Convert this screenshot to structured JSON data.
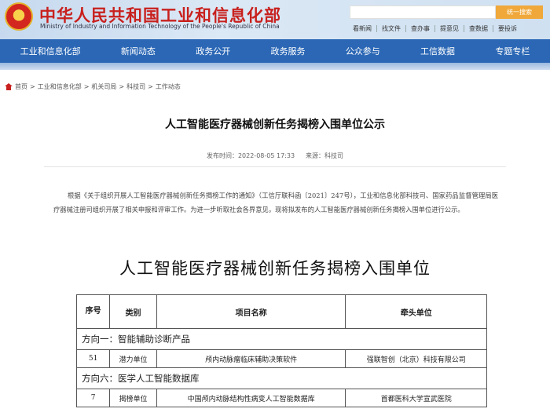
{
  "header": {
    "site_title": "中华人民共和国工业和信息化部",
    "site_subtitle": "Ministry of Industry and Information Technology of the People's Republic of China",
    "search_button": "统一搜索",
    "quick_links": [
      "看新闻",
      "找文件",
      "查办事",
      "提意见",
      "查数据",
      "要投诉"
    ]
  },
  "nav": {
    "items": [
      "工业和信息化部",
      "新闻动态",
      "政务公开",
      "政务服务",
      "公众参与",
      "工信数据",
      "专题专栏"
    ]
  },
  "breadcrumb": [
    "首页",
    "工业和信息化部",
    "机关司局",
    "科技司",
    "工作动态"
  ],
  "article": {
    "title": "人工智能医疗器械创新任务揭榜入围单位公示",
    "date": "发布时间：2022-08-05 17:33",
    "source": "来源：科技司",
    "body": "根据《关于组织开展人工智能医疗器械创新任务揭榜工作的通知》（工信厅联科函〔2021〕247号），工业和信息化部科技司、国家药品监督管理局医疗器械注册司组织开展了相关申报和评审工作。为进一步听取社会各界意见，现将拟发布的人工智能医疗器械创新任务揭榜入围单位进行公示。"
  },
  "table": {
    "title": "人工智能医疗器械创新任务揭榜入围单位",
    "headers": {
      "index": "序号",
      "category": "类别",
      "name": "项目名称",
      "lead": "牵头单位"
    },
    "groups": [
      {
        "heading": "方向一：智能辅助诊断产品",
        "rows": [
          {
            "index": "51",
            "category": "潜力单位",
            "name": "颅内动脉瘤临床辅助决策软件",
            "lead": "强联智创（北京）科技有限公司"
          }
        ]
      },
      {
        "heading": "方向六：医学人工智能数据库",
        "rows": [
          {
            "index": "7",
            "category": "揭榜单位",
            "name": "中国颅内动脉结构性病变人工智能数据库",
            "lead": "首都医科大学宣武医院"
          }
        ]
      }
    ]
  }
}
